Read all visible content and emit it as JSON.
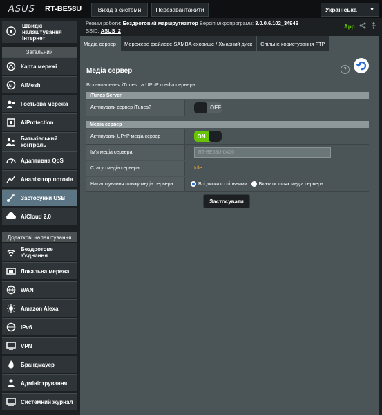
{
  "header": {
    "logo": "ASUS",
    "model": "RT-BE58U",
    "logout_label": "Вихід з системи",
    "reboot_label": "Перезавантажити",
    "language": "Українська"
  },
  "status": {
    "mode_label": "Режим роботи:",
    "mode_value": "Бездротовий маршрутизатор",
    "firmware_label": "Версія мікропрограми:",
    "firmware_value": "3.0.0.6.102_34946",
    "ssid_label": "SSID:",
    "ssid_value": "ASUS_2",
    "app_label": "App"
  },
  "sidebar": {
    "quick": "Швидкі налаштування Інтернет",
    "general_header": "Загальний",
    "general_items": [
      {
        "label": "Карта мережі",
        "icon": "network-map-icon"
      },
      {
        "label": "AiMesh",
        "icon": "aimesh-icon"
      },
      {
        "label": "Гостьова мережа",
        "icon": "guest-network-icon"
      },
      {
        "label": "AiProtection",
        "icon": "aiprotection-icon"
      },
      {
        "label": "Батьківський контроль",
        "icon": "parental-control-icon"
      },
      {
        "label": "Адаптивна QoS",
        "icon": "qos-icon"
      },
      {
        "label": "Аналізатор потоків",
        "icon": "traffic-analyzer-icon"
      },
      {
        "label": "Застосунки USB",
        "icon": "usb-icon"
      },
      {
        "label": "AiCloud 2.0",
        "icon": "aicloud-icon"
      }
    ],
    "advanced_header": "Додаткові налаштування",
    "advanced_items": [
      {
        "label": "Бездротове з'єднання",
        "icon": "wireless-icon"
      },
      {
        "label": "Локальна мережа",
        "icon": "lan-icon"
      },
      {
        "label": "WAN",
        "icon": "wan-icon"
      },
      {
        "label": "Amazon Alexa",
        "icon": "alexa-icon"
      },
      {
        "label": "IPv6",
        "icon": "ipv6-icon"
      },
      {
        "label": "VPN",
        "icon": "vpn-icon"
      },
      {
        "label": "Брандмауер",
        "icon": "firewall-icon"
      },
      {
        "label": "Адміністрування",
        "icon": "administration-icon"
      },
      {
        "label": "Системний журнал",
        "icon": "system-log-icon"
      }
    ]
  },
  "tabs": [
    "Медіа сервер",
    "Мережеве файлове SAMBA-сховище / Хмарний диск",
    "Спільне користування FTP"
  ],
  "main": {
    "title": "Медіа сервер",
    "description": "Встановлення iTunes та UPnP media сервера.",
    "itunes_header": "iTunes Server",
    "itunes_label": "Активувати сервер iTunes?",
    "itunes_toggle": "OFF",
    "media_header": "Медіа сервер",
    "upnp_label": "Активувати UPnP медіа сервер",
    "upnp_toggle": "ON",
    "name_label": "Ім'я медіа сервера",
    "name_value": "RT-BE58U-0A00",
    "status_label": "Статус медіа сервера",
    "status_value": "Idle",
    "path_label": "Налаштування шляху медіа сервера",
    "path_option1": "Всі диски с спільними",
    "path_option2": "Вказати шлях медіа сервера",
    "apply_label": "Застосувати"
  },
  "colors": {
    "accent_green": "#67c500",
    "active_item": "#5c7585",
    "status_idle": "#f0a93c"
  }
}
